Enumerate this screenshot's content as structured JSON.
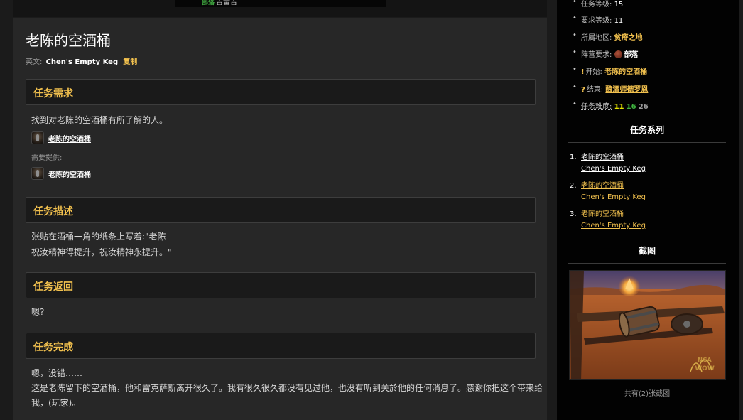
{
  "top_fragment": {
    "tag": "部落",
    "text": "吉雷吉"
  },
  "quest": {
    "title": "老陈的空酒桶",
    "english_label": "英文:",
    "english_name": "Chen's Empty Keg",
    "copy_label": "复制"
  },
  "sections": {
    "requirements": {
      "heading": "任务需求",
      "objective": "找到对老陈的空酒桶有所了解的人。",
      "item_label": "老陈的空酒桶",
      "provided_label": "需要提供:",
      "provided_item_label": "老陈的空酒桶"
    },
    "description": {
      "heading": "任务描述",
      "line1": "张贴在酒桶一角的纸条上写着:\"老陈 -",
      "line2": "祝汝精神得提升，祝汝精神永提升。\""
    },
    "progress": {
      "heading": "任务返回",
      "text": "嗯?"
    },
    "completion": {
      "heading": "任务完成",
      "line1": "嗯，没错……",
      "line2": "这是老陈留下的空酒桶，他和雷克萨斯离开很久了。我有很久很久都没有见过他，也没有听到关於他的任何消息了。感谢你把这个带来给",
      "line3": "我，(玩家)。"
    }
  },
  "sidebar": {
    "info": {
      "quest_level_label": "任务等级:",
      "quest_level": "15",
      "req_level_label": "要求等级:",
      "req_level": "11",
      "zone_label": "所属地区:",
      "zone": "贫瘠之地",
      "faction_label": "阵营要求:",
      "faction": "部落",
      "start_label": "开始:",
      "start": "老陈的空酒桶",
      "end_label": "结束:",
      "end": "酿酒师德罗恩",
      "difficulty_label": "任务难度:",
      "diff_yellow": "11",
      "diff_green": "16",
      "diff_gray": "26"
    },
    "series_heading": "任务系列",
    "series": [
      {
        "num": "1.",
        "cn": "老陈的空酒桶",
        "en": "Chen's Empty Keg"
      },
      {
        "num": "2.",
        "cn": "老陈的空酒桶",
        "en": "Chen's Empty Keg"
      },
      {
        "num": "3.",
        "cn": "老陈的空酒桶",
        "en": "Chen's Empty Keg"
      }
    ],
    "screenshot_heading": "截图",
    "screenshot_caption": "共有(2)张截图",
    "watermark": "NGA WOW"
  },
  "colors": {
    "accent": "#f2c14e",
    "panel": "#272727",
    "section_header": "#1a1a1a",
    "sidebar": "#020202",
    "diff_yellow": "#e6e600",
    "diff_green": "#3fb13f",
    "diff_gray": "#9a9a9a"
  },
  "icons": [
    "item-keg-icon",
    "horde-icon",
    "quest-start-icon",
    "quest-end-icon"
  ]
}
